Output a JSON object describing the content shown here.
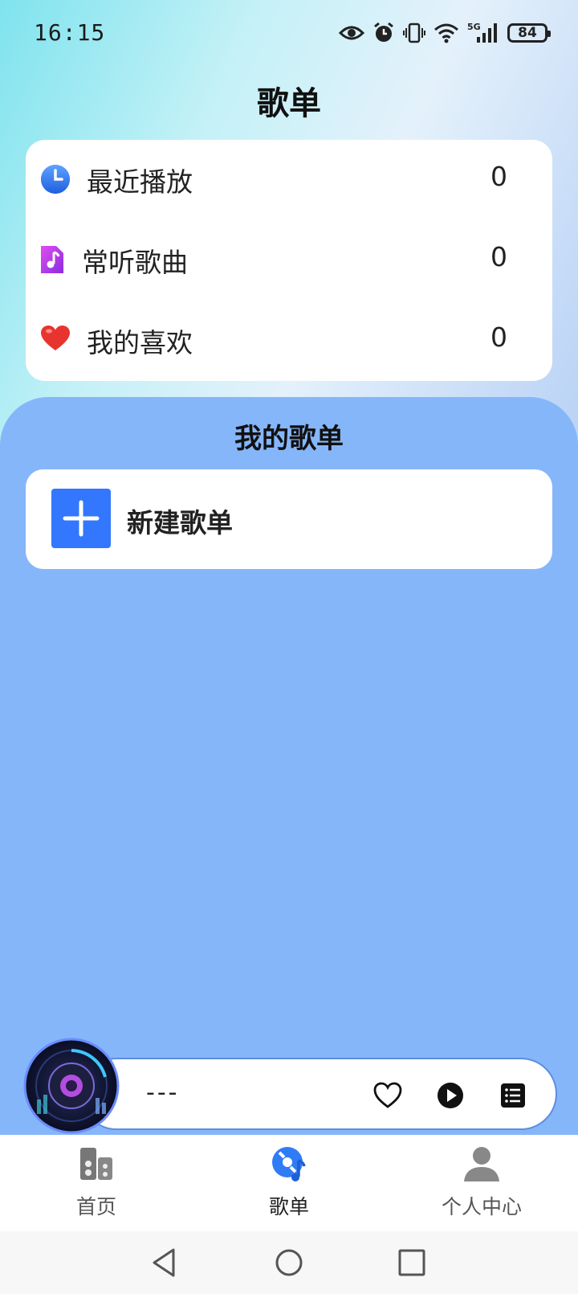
{
  "status_bar": {
    "time": "16:15",
    "icons": [
      "eye-icon",
      "alarm-icon",
      "vibrate-icon",
      "wifi-icon",
      "5g-signal-icon"
    ],
    "network_label": "5G",
    "battery": "84"
  },
  "header": {
    "title": "歌单"
  },
  "quick_lists": [
    {
      "label": "最近播放",
      "count": "0",
      "icon": "clock-icon",
      "color": "#2f7cf6"
    },
    {
      "label": "常听歌曲",
      "count": "0",
      "icon": "music-note-icon",
      "color": "#b43de8"
    },
    {
      "label": "我的喜欢",
      "count": "0",
      "icon": "heart-icon",
      "color": "#e8342f"
    }
  ],
  "my_playlists": {
    "title": "我的歌单",
    "new_label": "新建歌单",
    "accent": "#3377ff"
  },
  "player": {
    "song_title": "---",
    "icons": [
      "heart-outline-icon",
      "play-icon",
      "playlist-icon"
    ]
  },
  "tabs": [
    {
      "label": "首页",
      "icon": "speaker-icon"
    },
    {
      "label": "歌单",
      "icon": "disc-note-icon"
    },
    {
      "label": "个人中心",
      "icon": "person-icon"
    }
  ],
  "panel_color": "#86b6fa"
}
